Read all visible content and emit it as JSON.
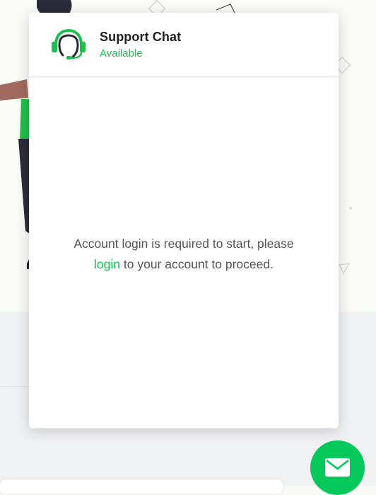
{
  "chat": {
    "title": "Support Chat",
    "status": "Available",
    "message_prefix": "Account login is required to start, please",
    "login_link": "login",
    "message_suffix": " to your account to proceed."
  },
  "icons": {
    "header_icon": "headset-icon",
    "launcher_icon": "mail-icon"
  },
  "colors": {
    "accent": "#1dbf4f",
    "launcher": "#05c85b",
    "title_text": "#1f1f1f",
    "body_text": "#555555"
  }
}
